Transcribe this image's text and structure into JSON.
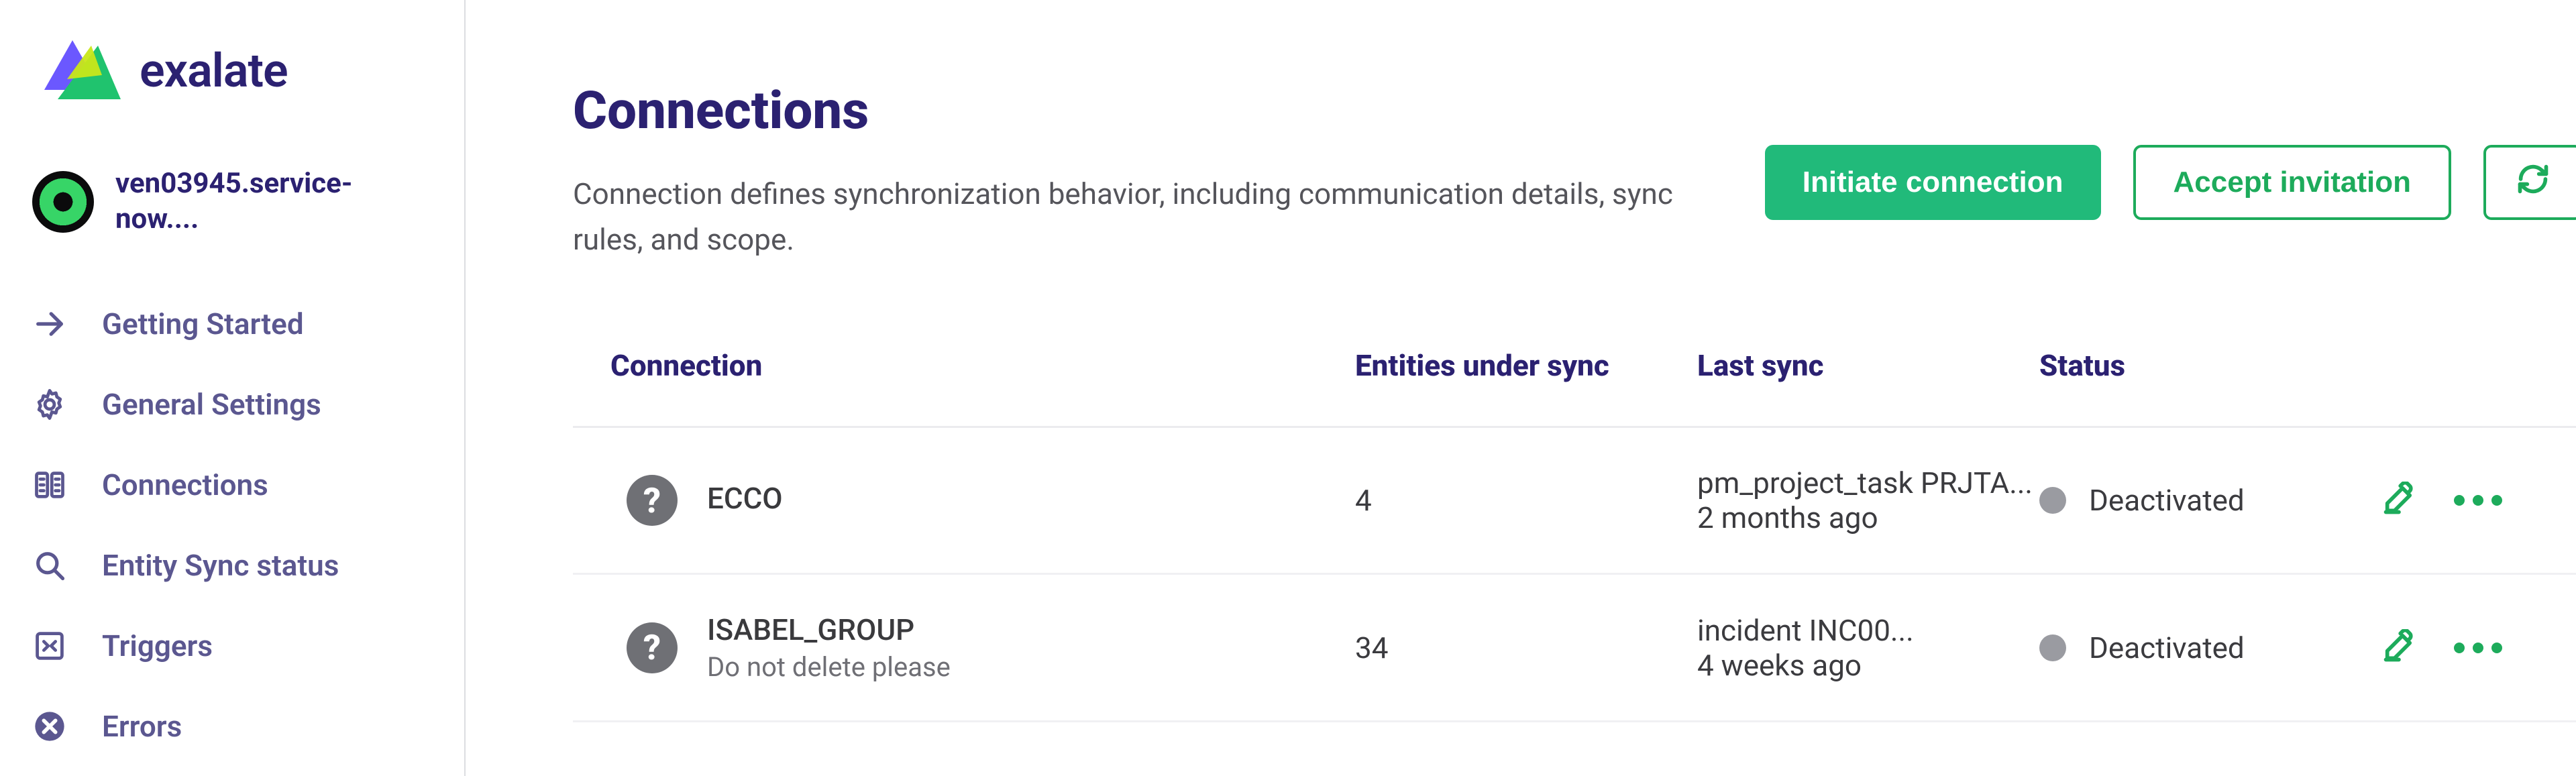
{
  "brand": {
    "name": "exalate"
  },
  "account": {
    "label": "ven03945.service-now...."
  },
  "sidebar": {
    "items": [
      {
        "label": "Getting Started"
      },
      {
        "label": "General Settings"
      },
      {
        "label": "Connections"
      },
      {
        "label": "Entity Sync status"
      },
      {
        "label": "Triggers"
      },
      {
        "label": "Errors"
      }
    ]
  },
  "page": {
    "title": "Connections",
    "subtitle": "Connection defines synchronization behavior, including communication details, sync rules, and scope."
  },
  "actions": {
    "initiate": "Initiate connection",
    "accept": "Accept invitation"
  },
  "table": {
    "headers": {
      "connection": "Connection",
      "entities": "Entities under sync",
      "lastSync": "Last sync",
      "status": "Status"
    },
    "rows": [
      {
        "help": "?",
        "name": "ECCO",
        "desc": "",
        "entities": "4",
        "lastSyncTitle": "pm_project_task PRJTA...",
        "lastSyncTime": "2 months ago",
        "status": "Deactivated"
      },
      {
        "help": "?",
        "name": "ISABEL_GROUP",
        "desc": "Do not delete please",
        "entities": "34",
        "lastSyncTitle": "incident INC00...",
        "lastSyncTime": "4 weeks ago",
        "status": "Deactivated"
      }
    ]
  }
}
